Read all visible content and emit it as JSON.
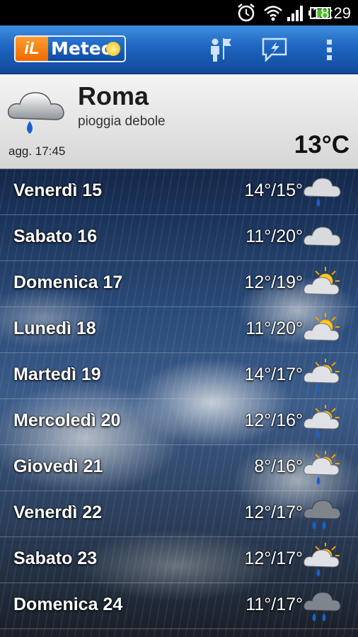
{
  "status_bar": {
    "time": "18:29",
    "icons": [
      "alarm-icon",
      "wifi-icon",
      "signal-icon",
      "battery-icon"
    ]
  },
  "app_bar": {
    "logo_prefix": "iL",
    "logo_text": "Meteo",
    "actions": [
      "locations-icon",
      "alerts-icon",
      "overflow-menu-icon"
    ]
  },
  "current": {
    "city": "Roma",
    "condition": "pioggia debole",
    "updated": "agg. 17:45",
    "temperature": "13°C",
    "icon": "rain-cloud-icon"
  },
  "forecast": [
    {
      "day": "Venerdì 15",
      "temps": "14°/15°",
      "icon": "cloud-rain"
    },
    {
      "day": "Sabato 16",
      "temps": "11°/20°",
      "icon": "cloud"
    },
    {
      "day": "Domenica 17",
      "temps": "12°/19°",
      "icon": "sun-cloud"
    },
    {
      "day": "Lunedì 18",
      "temps": "11°/20°",
      "icon": "sun-cloud"
    },
    {
      "day": "Martedì 19",
      "temps": "14°/17°",
      "icon": "sun-cloud-rain"
    },
    {
      "day": "Mercoledì 20",
      "temps": "12°/16°",
      "icon": "sun-cloud-rain"
    },
    {
      "day": "Giovedì 21",
      "temps": "8°/16°",
      "icon": "sun-cloud-rain"
    },
    {
      "day": "Venerdì 22",
      "temps": "12°/17°",
      "icon": "dark-cloud-rain"
    },
    {
      "day": "Sabato 23",
      "temps": "12°/17°",
      "icon": "sun-cloud-rain"
    },
    {
      "day": "Domenica 24",
      "temps": "11°/17°",
      "icon": "dark-cloud-rain"
    }
  ],
  "colors": {
    "appbar": "#1e64bf",
    "header_bg": "#e6e6e6",
    "logo_orange": "#f06a00"
  }
}
